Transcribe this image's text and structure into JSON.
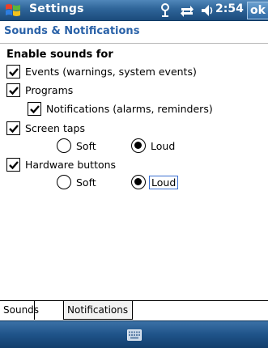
{
  "titlebar": {
    "title": "Settings",
    "time": "2:54",
    "ok_label": "ok",
    "icons": [
      "windows-start-icon",
      "connectivity-icon",
      "sync-icon",
      "volume-icon"
    ]
  },
  "header": {
    "title": "Sounds & Notifications"
  },
  "content": {
    "heading": "Enable sounds for",
    "checkboxes": [
      {
        "label": "Events (warnings, system events)",
        "checked": true
      },
      {
        "label": "Programs",
        "checked": true
      },
      {
        "label": "Notifications (alarms, reminders)",
        "checked": true
      },
      {
        "label": "Screen taps",
        "checked": true
      },
      {
        "label": "Hardware buttons",
        "checked": true
      }
    ],
    "screen_taps": {
      "options": [
        "Soft",
        "Loud"
      ],
      "selected": "Loud"
    },
    "hardware_buttons": {
      "options": [
        "Soft",
        "Loud"
      ],
      "selected": "Loud"
    }
  },
  "tabs": [
    {
      "label": "Sounds",
      "active": true
    },
    {
      "label": "Notifications",
      "active": false
    }
  ],
  "colors": {
    "title_bar": "#2e6498",
    "header_text": "#2a62a8",
    "focus_border": "#3b6fd1"
  }
}
